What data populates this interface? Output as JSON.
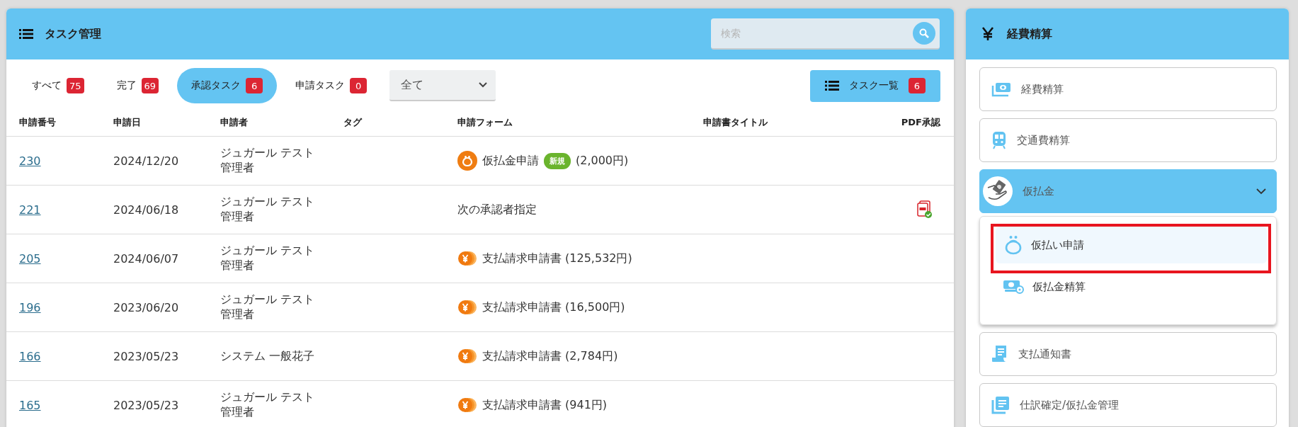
{
  "task_panel": {
    "title": "タスク管理",
    "search": {
      "placeholder": "検索"
    },
    "filters": [
      {
        "label": "すべて",
        "count": "75",
        "selected": false
      },
      {
        "label": "完了",
        "count": "69",
        "selected": false
      },
      {
        "label": "承認タスク",
        "count": "6",
        "selected": true
      },
      {
        "label": "申請タスク",
        "count": "0",
        "selected": false
      }
    ],
    "select": {
      "value": "全て"
    },
    "list_button": {
      "label": "タスク一覧",
      "count": "6"
    },
    "table": {
      "columns": [
        "申請番号",
        "申請日",
        "申請者",
        "タグ",
        "申請フォーム",
        "申請書タイトル",
        "PDF承認"
      ],
      "rows": [
        {
          "number": "230",
          "date": "2024/12/20",
          "applicant": "ジュガール テスト",
          "role": "管理者",
          "form": {
            "kind": "purse",
            "text": "仮払金申請",
            "badge": "新規",
            "amount": "(2,000円)"
          },
          "pdf": false
        },
        {
          "number": "221",
          "date": "2024/06/18",
          "applicant": "ジュガール テスト",
          "role": "管理者",
          "form": {
            "kind": "text",
            "text": "次の承認者指定"
          },
          "pdf": true
        },
        {
          "number": "205",
          "date": "2024/06/07",
          "applicant": "ジュガール テスト",
          "role": "管理者",
          "form": {
            "kind": "coins",
            "text": "支払請求申請書 (125,532円)"
          },
          "pdf": false
        },
        {
          "number": "196",
          "date": "2023/06/20",
          "applicant": "ジュガール テスト",
          "role": "管理者",
          "form": {
            "kind": "coins",
            "text": "支払請求申請書 (16,500円)"
          },
          "pdf": false
        },
        {
          "number": "166",
          "date": "2023/05/23",
          "applicant": "システム 一般花子",
          "form": {
            "kind": "coins",
            "text": "支払請求申請書 (2,784円)"
          },
          "pdf": false
        },
        {
          "number": "165",
          "date": "2023/05/23",
          "applicant": "ジュガール テスト",
          "role": "管理者",
          "form": {
            "kind": "coins",
            "text": "支払請求申請書 (941円)"
          },
          "pdf": false
        }
      ]
    }
  },
  "expense_panel": {
    "title": "経費精算",
    "items": [
      {
        "label": "経費精算",
        "kind": "cash",
        "expanded": false
      },
      {
        "label": "交通費精算",
        "kind": "train",
        "expanded": false
      },
      {
        "label": "仮払金",
        "kind": "hand",
        "expanded": true,
        "children": [
          {
            "label": "仮払い申請",
            "kind": "purse",
            "selected": true,
            "highlight_frame": true
          },
          {
            "label": "仮払金精算",
            "kind": "money",
            "selected": false,
            "highlight_frame": false
          }
        ]
      },
      {
        "label": "支払通知書",
        "kind": "receipt",
        "expanded": false
      },
      {
        "label": "仕訳確定/仮払金管理",
        "kind": "docs",
        "expanded": false
      }
    ]
  }
}
